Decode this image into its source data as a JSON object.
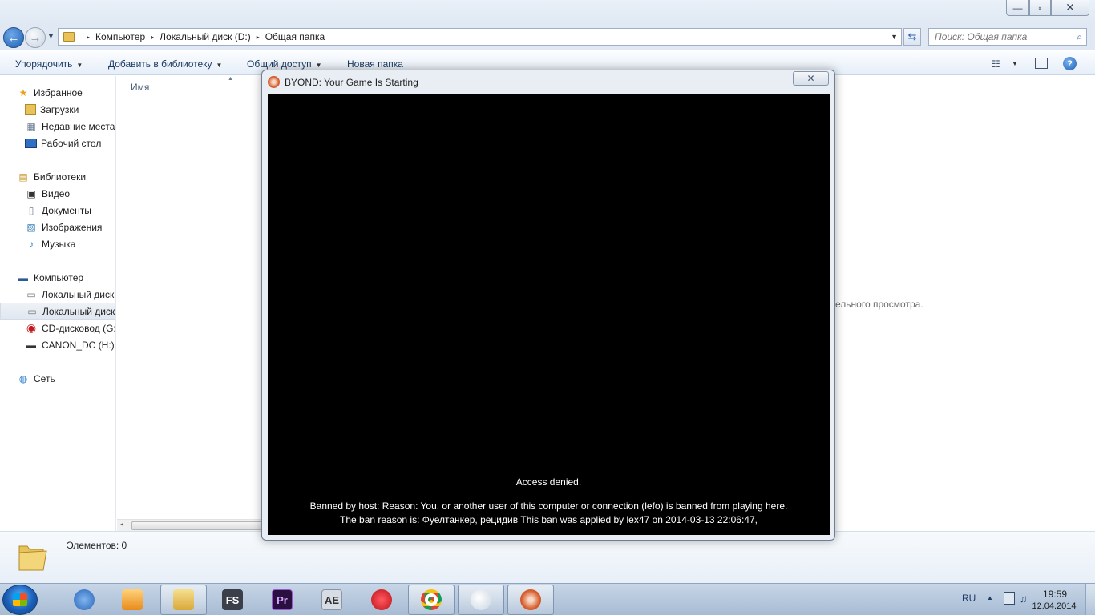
{
  "window": {
    "minimize_glyph": "—",
    "maximize_glyph": "▫",
    "close_glyph": "✕"
  },
  "address_bar": {
    "crumbs": [
      "Компьютер",
      "Локальный диск (D:)",
      "Общая папка"
    ],
    "separator": "▸"
  },
  "search": {
    "placeholder": "Поиск: Общая папка"
  },
  "toolbar": {
    "organize": "Упорядочить",
    "add_to_library": "Добавить в библиотеку",
    "share": "Общий доступ",
    "new_folder": "Новая папка"
  },
  "sidebar": {
    "favorites": "Избранное",
    "downloads": "Загрузки",
    "recent": "Недавние места",
    "desktop": "Рабочий стол",
    "libraries": "Библиотеки",
    "video": "Видео",
    "documents": "Документы",
    "images": "Изображения",
    "music": "Музыка",
    "computer": "Компьютер",
    "local_disk_c": "Локальный диск",
    "local_disk_d": "Локальный диск",
    "cd_drive": "CD-дисковод (G:",
    "canon": "CANON_DC (H:)",
    "network": "Сеть"
  },
  "content": {
    "column_name": "Имя",
    "preview_message": "ельного просмотра."
  },
  "details": {
    "items_count": "Элементов: 0"
  },
  "dialog": {
    "title": "BYOND: Your Game Is Starting",
    "access_denied": "Access denied.",
    "ban_line_1": "Banned by host:  Reason: You, or another user of this computer or connection (lefo) is banned from playing here.",
    "ban_line_2": "The ban reason is: Фуелтанкер, рецидив This ban was applied by lex47 on 2014-03-13 22:06:47,"
  },
  "taskbar": {
    "apps": [
      {
        "name": "thunderbird-icon",
        "label": ""
      },
      {
        "name": "media-player-icon",
        "label": ""
      },
      {
        "name": "explorer-icon",
        "label": ""
      },
      {
        "name": "fs-app-icon",
        "label": "FS"
      },
      {
        "name": "premiere-icon",
        "label": "Pr"
      },
      {
        "name": "after-effects-icon",
        "label": "AE"
      },
      {
        "name": "opera-icon",
        "label": ""
      },
      {
        "name": "chrome-icon",
        "label": ""
      },
      {
        "name": "paint-icon",
        "label": ""
      },
      {
        "name": "byond-icon",
        "label": ""
      }
    ],
    "language": "RU",
    "time": "19:59",
    "date": "12.04.2014"
  },
  "colors": {
    "accent": "#1d5fb4",
    "game_screen": "#000000",
    "byond_orange": "#d9602e"
  }
}
